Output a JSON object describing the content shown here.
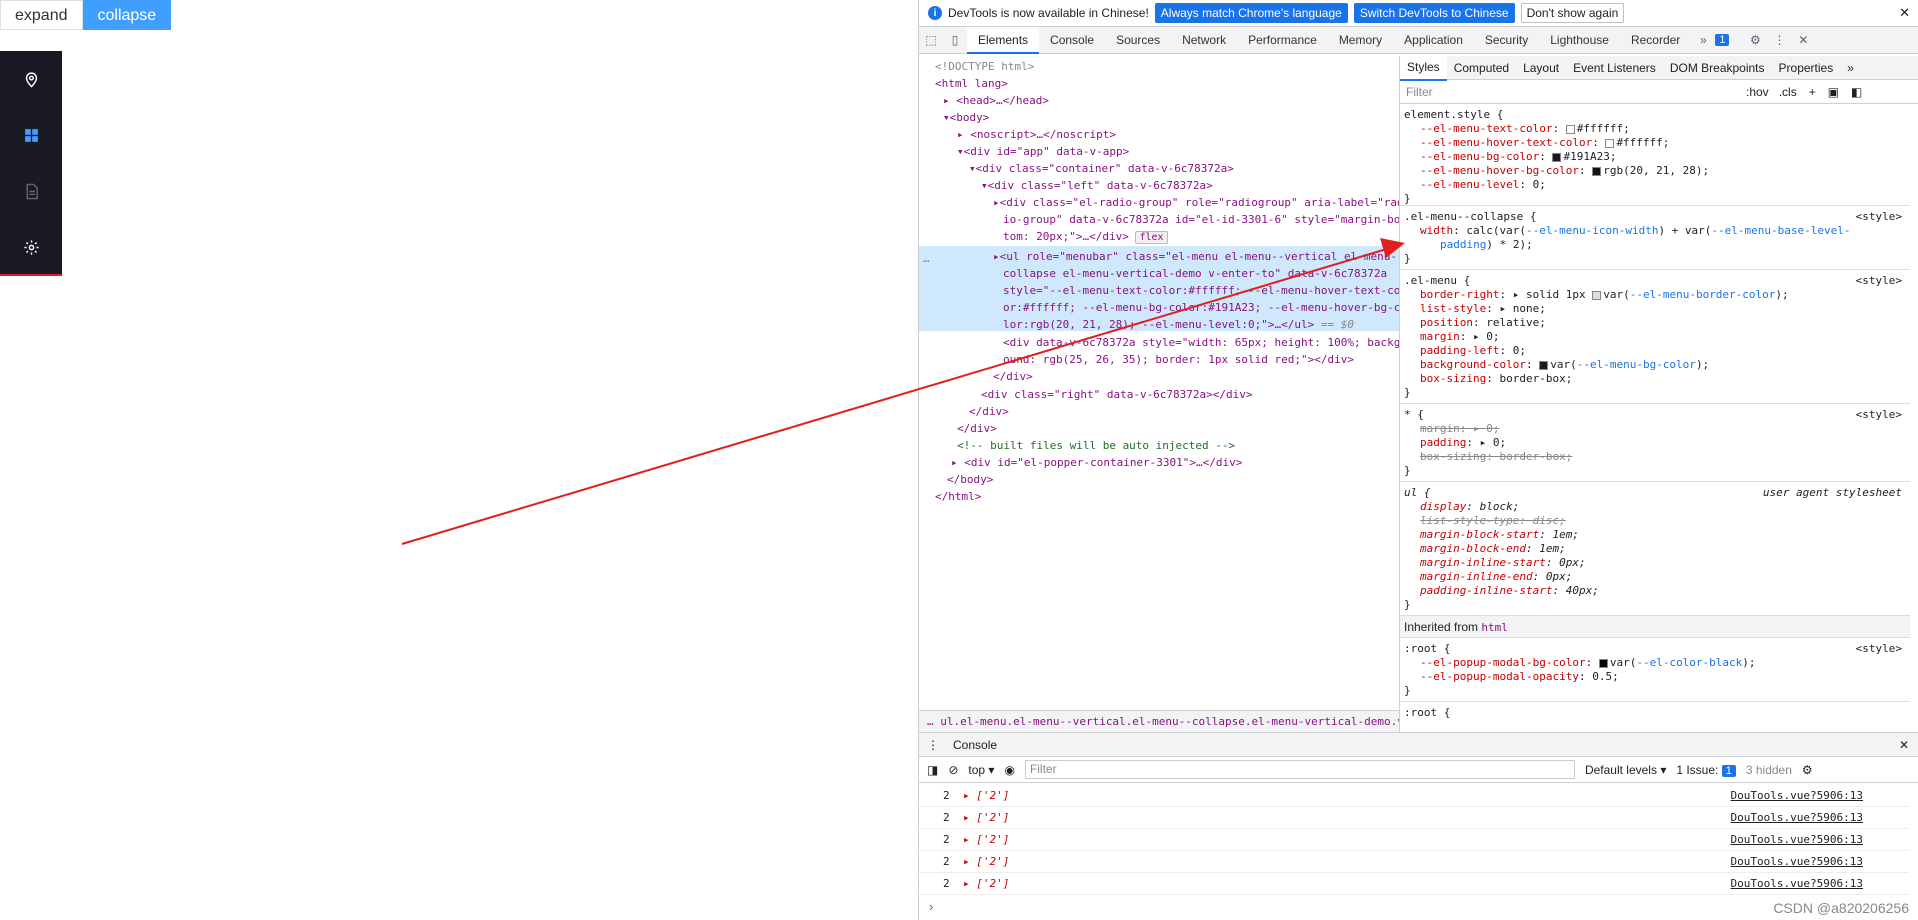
{
  "app": {
    "expand_label": "expand",
    "collapse_label": "collapse"
  },
  "menu": {
    "items": [
      "location-icon",
      "grid-icon",
      "document-icon",
      "gear-icon"
    ],
    "bg_color": "#191a23",
    "active_color": "#409eff"
  },
  "infobar": {
    "text": "DevTools is now available in Chinese!",
    "btn_match": "Always match Chrome's language",
    "btn_switch": "Switch DevTools to Chinese",
    "btn_dismiss": "Don't show again"
  },
  "tabs": {
    "items": [
      "Elements",
      "Console",
      "Sources",
      "Network",
      "Performance",
      "Memory",
      "Application",
      "Security",
      "Lighthouse",
      "Recorder"
    ],
    "badge": "1"
  },
  "elements": {
    "lines": [
      "<!DOCTYPE html>",
      "<html lang>",
      "<head>…</head>",
      "<body>",
      "<noscript>…</noscript>",
      "<div id=\"app\" data-v-app>",
      "<div class=\"container\" data-v-6c78372a>",
      "<div class=\"left\" data-v-6c78372a>",
      "<div class=\"el-radio-group\" role=\"radiogroup\" aria-label=\"rad",
      "io-group\" data-v-6c78372a id=\"el-id-3301-6\" style=\"margin-bot",
      "tom: 20px;\">…</div>",
      "<ul role=\"menubar\" class=\"el-menu el-menu--vertical el-menu--",
      "collapse el-menu-vertical-demo v-enter-to\" data-v-6c78372a",
      "style=\"--el-menu-text-color:#ffffff; --el-menu-hover-text-col",
      "or:#ffffff; --el-menu-bg-color:#191A23; --el-menu-hover-bg-co",
      "lor:rgb(20, 21, 28); --el-menu-level:0;\">…</ul>",
      "<div data-v-6c78372a style=\"width: 65px; height: 100%; backgr",
      "ound: rgb(25, 26, 35); border: 1px solid red;\"></div>",
      "</div>",
      "<div class=\"right\" data-v-6c78372a></div>",
      "</div>",
      "</div>",
      "<!-- built files will be auto injected -->",
      "<div id=\"el-popper-container-3301\">…</div>",
      "</body>",
      "</html>"
    ],
    "flex_badge": "flex",
    "eq_dollar": "== $0",
    "dots": "…",
    "breadcrumb": "ul.el-menu.el-menu--vertical.el-menu--collapse.el-menu-vertical-demo.v-enter"
  },
  "styles": {
    "subtabs": [
      "Styles",
      "Computed",
      "Layout",
      "Event Listeners",
      "DOM Breakpoints",
      "Properties"
    ],
    "filter_placeholder": "Filter",
    "hov": ":hov",
    "cls": ".cls",
    "element_style": {
      "selector": "element.style {",
      "props": [
        [
          "--el-menu-text-color",
          "#ffffff"
        ],
        [
          "--el-menu-hover-text-color",
          "#ffffff"
        ],
        [
          "--el-menu-bg-color",
          "#191A23"
        ],
        [
          "--el-menu-hover-bg-color",
          "rgb(20, 21, 28)"
        ],
        [
          "--el-menu-level",
          "0"
        ]
      ]
    },
    "collapse_rule": {
      "selector": ".el-menu--collapse {",
      "source": "<style>",
      "prop": "width",
      "value_a": "calc(var(",
      "var_a": "--el-menu-icon-width",
      "value_b": ") + var(",
      "var_b": "--el-menu-base-level-",
      "var_b2": "padding",
      "value_c": ") * 2);"
    },
    "menu_rule": {
      "selector": ".el-menu {",
      "source": "<style>",
      "lines": [
        [
          "border-right",
          "solid 1px",
          "--el-menu-border-color"
        ],
        [
          "list-style",
          "none"
        ],
        [
          "position",
          "relative"
        ],
        [
          "margin",
          "0"
        ],
        [
          "padding-left",
          "0"
        ],
        [
          "background-color",
          "",
          "--el-menu-bg-color"
        ],
        [
          "box-sizing",
          "border-box"
        ]
      ]
    },
    "star_rule": {
      "selector": "* {",
      "source": "<style>",
      "lines": [
        [
          "margin",
          "0"
        ],
        [
          "padding",
          "0"
        ],
        [
          "box-sizing",
          "border-box"
        ]
      ]
    },
    "ul_rule": {
      "selector": "ul {",
      "source": "user agent stylesheet",
      "lines": [
        [
          "display",
          "block"
        ],
        [
          "list-style-type",
          "disc"
        ],
        [
          "margin-block-start",
          "1em"
        ],
        [
          "margin-block-end",
          "1em"
        ],
        [
          "margin-inline-start",
          "0px"
        ],
        [
          "margin-inline-end",
          "0px"
        ],
        [
          "padding-inline-start",
          "40px"
        ]
      ]
    },
    "inherited_label": "Inherited from",
    "inherited_tag": "html",
    "root_rule": {
      "selector": ":root {",
      "source": "<style>",
      "lines": [
        [
          "--el-popup-modal-bg-color",
          "var(",
          "--el-color-black",
          ")"
        ],
        [
          "--el-popup-modal-opacity",
          "0.5"
        ]
      ]
    },
    "root2": ":root {",
    "close": "}"
  },
  "console": {
    "tab": "Console",
    "context": "top",
    "filter_placeholder": "Filter",
    "levels": "Default levels",
    "issues": "1 Issue:",
    "issues_count": "1",
    "hidden": "3 hidden",
    "rows": [
      {
        "count": "2",
        "value": "['2']",
        "link": "DouTools.vue?5906:13"
      },
      {
        "count": "2",
        "value": "['2']",
        "link": "DouTools.vue?5906:13"
      },
      {
        "count": "2",
        "value": "['2']",
        "link": "DouTools.vue?5906:13"
      },
      {
        "count": "2",
        "value": "['2']",
        "link": "DouTools.vue?5906:13"
      },
      {
        "count": "2",
        "value": "['2']",
        "link": "DouTools.vue?5906:13"
      }
    ],
    "prompt": "›"
  },
  "watermark": "CSDN @a820206256",
  "annotation_color": "#e02020"
}
